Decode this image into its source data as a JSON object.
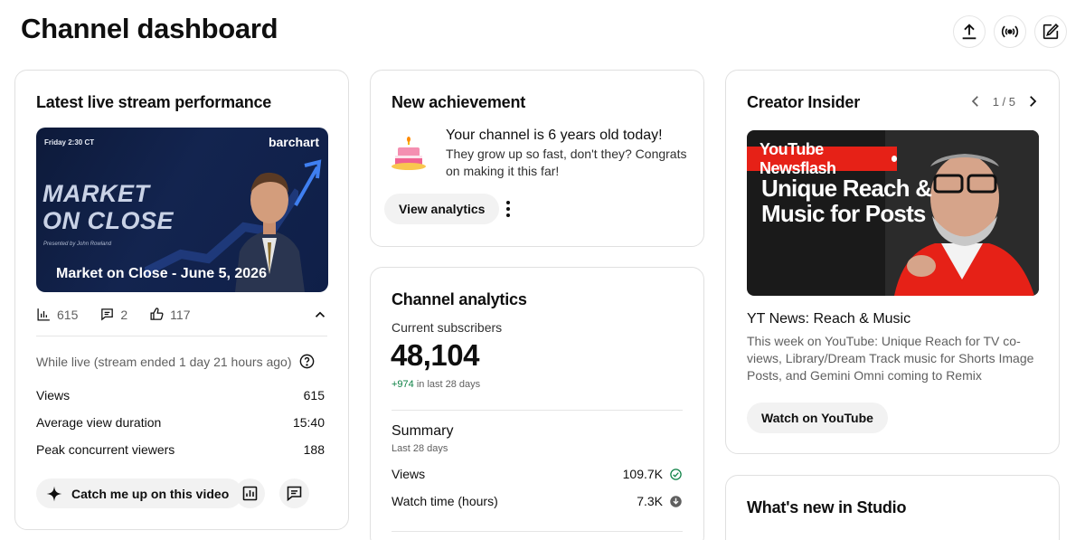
{
  "page": {
    "title": "Channel dashboard"
  },
  "top_actions": [
    {
      "name": "upload-icon"
    },
    {
      "name": "go-live-icon"
    },
    {
      "name": "create-post-icon"
    }
  ],
  "live_card": {
    "title": "Latest live stream performance",
    "thumbnail": {
      "date_label": "Friday 2:30 CT",
      "brand": "barchart",
      "big_title_line1": "MARKET",
      "big_title_line2": "ON CLOSE",
      "presenter": "Presented by John Rowland",
      "caption": "Market on Close - June 5, 2026"
    },
    "stats": {
      "views": "615",
      "comments": "2",
      "likes": "117"
    },
    "while_live": "While live (stream ended 1 day 21 hours ago)",
    "metrics": [
      {
        "label": "Views",
        "value": "615"
      },
      {
        "label": "Average view duration",
        "value": "15:40"
      },
      {
        "label": "Peak concurrent viewers",
        "value": "188"
      }
    ],
    "catch_up_label": "Catch me up on this video"
  },
  "achievement_card": {
    "title": "New achievement",
    "headline": "Your channel is 6 years old today!",
    "body": "They grow up so fast, don't they? Congrats on making it this far!",
    "button": "View analytics"
  },
  "analytics_card": {
    "title": "Channel analytics",
    "subscribers_label": "Current subscribers",
    "subscribers": "48,104",
    "change": "+974",
    "change_suffix": "in last 28 days",
    "summary_title": "Summary",
    "summary_period": "Last 28 days",
    "metrics": [
      {
        "label": "Views",
        "value": "109.7K",
        "status": "check"
      },
      {
        "label": "Watch time (hours)",
        "value": "7.3K",
        "status": "down"
      }
    ]
  },
  "insider_card": {
    "title": "Creator Insider",
    "pager": "1 / 5",
    "thumbnail": {
      "band": "YouTube Newsflash",
      "headline_line1": "Unique Reach &",
      "headline_line2": "Music for Posts"
    },
    "video_title": "YT News: Reach & Music",
    "description": "This week on YouTube: Unique Reach for TV co-views, Library/Dream Track music for Shorts Image Posts, and Gemini Omni coming to Remix",
    "button": "Watch on YouTube"
  },
  "whats_new_card": {
    "title": "What's new in Studio"
  },
  "colors": {
    "positive": "#0b8043",
    "accent_red": "#e62117",
    "thumb_navy": "#13244f"
  }
}
